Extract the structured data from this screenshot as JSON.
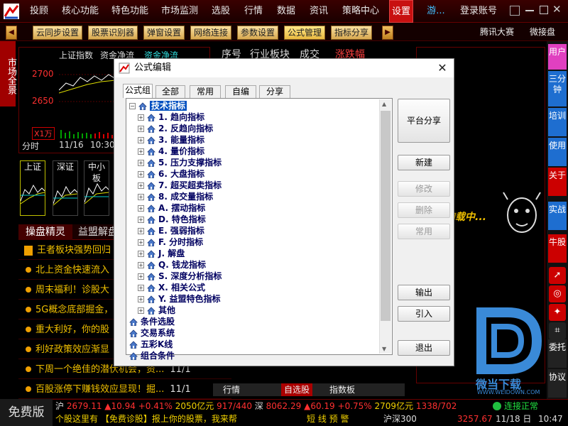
{
  "menu": {
    "items": [
      "投顾",
      "核心功能",
      "特色功能",
      "市场监测",
      "选股",
      "行情",
      "数据",
      "资讯",
      "策略中心",
      "设置"
    ],
    "active_index": 9,
    "guest_label": "游...",
    "login_label": "登录账号"
  },
  "toolbar": {
    "buttons": [
      "云同步设置",
      "股票识别器",
      "弹窗设置",
      "网络连接",
      "参数设置",
      "公式管理",
      "指标分享"
    ],
    "active_index": 5,
    "right_links": [
      "腾讯大赛",
      "微接盘"
    ]
  },
  "left_strip": {
    "label": "市场全景"
  },
  "chart": {
    "index_name": "上证指数",
    "flow_label": "资金净流",
    "flow_label2": "资金净流",
    "y_labels": [
      "2700",
      "2650"
    ],
    "vol_label": "X1万",
    "period_label": "分时",
    "date_label": "11/16",
    "time_label": "10:30"
  },
  "mini_cards": [
    "上证",
    "深证",
    "中小板",
    "创"
  ],
  "mid_header": {
    "columns": [
      "序号",
      "行业板块",
      "成交",
      "涨跌幅"
    ]
  },
  "news": {
    "tabs": [
      "操盘精灵",
      "益盟解盘"
    ],
    "items": [
      "王者板块强势回归",
      "北上资金快速流入",
      "周末福利！诊股大",
      "5G概念底部掘金，",
      "重大利好，你的股",
      "利好政策效应渐显",
      "下周一个绝佳的潜伏机会，资...",
      "百股涨停下赚钱效应显现！掘..."
    ],
    "dates": [
      "11/1",
      "11/1"
    ]
  },
  "bottom_tabs": [
    "行情",
    "自选股",
    "指数板"
  ],
  "right_panel": {
    "loading": "加载中..."
  },
  "right_sidebar": {
    "tabs": [
      "用户",
      "三分钟",
      "培训",
      "使用",
      "关于",
      "实战",
      "牛股",
      "委托",
      "协议"
    ]
  },
  "dialog": {
    "title": "公式编辑",
    "close": "✕",
    "tabs": [
      "公式组",
      "全部",
      "常用",
      "自编",
      "分享"
    ],
    "active_tab": 0,
    "tree_root": "技术指标",
    "tree_items": [
      "1. 趋向指标",
      "2. 反趋向指标",
      "3. 能量指标",
      "4. 量价指标",
      "5. 压力支撑指标",
      "6. 大盘指标",
      "7. 超买超卖指标",
      "8. 成交量指标",
      "A. 摆动指标",
      "D. 特色指标",
      "E. 强弱指标",
      "F. 分时指标",
      "J. 解盘",
      "Q. 钱龙指标",
      "S. 深度分析指标",
      "X. 相关公式",
      "Y. 益盟特色指标",
      "其他"
    ],
    "tree_roots2": [
      "条件选股",
      "交易系统",
      "五彩K线",
      "组合条件"
    ],
    "buttons": {
      "share": "平台分享",
      "new": "新建",
      "modify": "修改",
      "delete": "删除",
      "common": "常用",
      "export": "输出",
      "import": "引入",
      "exit": "退出"
    }
  },
  "status": {
    "free_version": "免费版",
    "sh_label": "沪",
    "sh_index": "2679.11",
    "sh_change": "▲10.94",
    "sh_pct": "+0.41%",
    "sh_amount": "2050亿元",
    "sh_updown": "917/440",
    "sz_label": "深",
    "sz_index": "8062.29",
    "sz_change": "▲60.19",
    "sz_pct": "+0.75%",
    "sz_amount": "2709亿元",
    "sz_updown": "1338/702",
    "conn": "连接正常",
    "ticker": "个股这里有   【免费诊股】报上你的股票，我来帮",
    "ticker2": "短 线 预 警",
    "hs300_label": "沪深300",
    "hs300": "3257.67",
    "date": "11/18 日",
    "time": "10:47"
  },
  "watermark": {
    "text": "微当下载",
    "url": "WWW.WEIDOWN.COM"
  },
  "colors": {
    "accent_red": "#c81010",
    "dialog_select": "#0050c0",
    "quote_up": "#ff3030"
  }
}
